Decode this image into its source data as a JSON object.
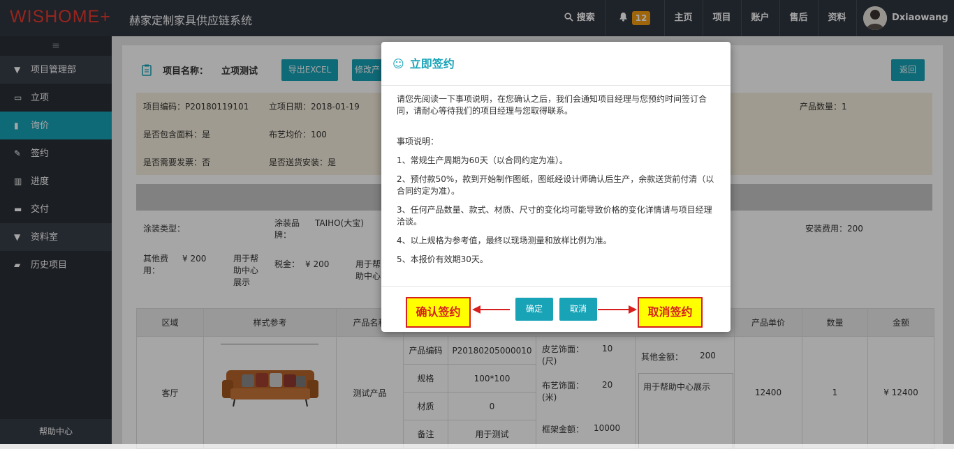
{
  "topbar": {
    "logo": "WISHOME+",
    "system_title": "赫家定制家具供应链系统",
    "search_label": "搜索",
    "notification_count": "12",
    "nav": [
      "主页",
      "项目",
      "账户",
      "售后",
      "资料"
    ],
    "username": "Dxiaowang"
  },
  "sidebar": {
    "toggle": "≡",
    "items": [
      {
        "label": "项目管理部",
        "icon": "caret-down-icon",
        "type": "group"
      },
      {
        "label": "立项",
        "icon": "calendar-icon",
        "type": "item"
      },
      {
        "label": "询价",
        "icon": "file-icon",
        "type": "item",
        "active": true
      },
      {
        "label": "签约",
        "icon": "edit-icon",
        "type": "item"
      },
      {
        "label": "进度",
        "icon": "bar-chart-icon",
        "type": "item"
      },
      {
        "label": "交付",
        "icon": "inbox-icon",
        "type": "item"
      },
      {
        "label": "资料室",
        "icon": "caret-down-icon",
        "type": "group"
      },
      {
        "label": "历史项目",
        "icon": "folder-icon",
        "type": "item"
      }
    ],
    "help": "帮助中心"
  },
  "project": {
    "name_label": "项目名称：",
    "name": "立项测试",
    "export_btn": "导出EXCEL",
    "modify_btn": "修改产",
    "back_btn": "返回",
    "code": "项目编码：P20180119101",
    "date": "立项日期：2018-01-19",
    "quantity": "产品数量：1",
    "includes_fabric": "是否包含面料：是",
    "cloth_avg": "布艺均价：100",
    "need_invoice": "是否需要发票：否",
    "deliver_install": "是否送货安装：是",
    "paint_type_label": "涂装类型：",
    "paint_brand_label": "涂装品牌：",
    "paint_brand_value": "TAIHO(大宝)",
    "install_fee": "安装费用：200",
    "other_fee_label": "其他费用：",
    "other_fee_value": "¥ 200",
    "help_display": "用于帮助中心展示",
    "tax_label": "税金：",
    "tax_value": "¥ 200",
    "help_display_short": "用于帮助中心展"
  },
  "table": {
    "headers": [
      "区域",
      "样式参考",
      "产品名称",
      "产品单价",
      "数量",
      "金额"
    ],
    "row": {
      "area": "客厅",
      "product_name": "测试产品",
      "attrs": [
        {
          "k": "产品编码",
          "v": "P20180205000010"
        },
        {
          "k": "规格",
          "v": "100*100"
        },
        {
          "k": "材质",
          "v": "0"
        },
        {
          "k": "备注",
          "v": "用于测试"
        }
      ],
      "leather_label": "皮艺饰面：(尺)",
      "leather_value": "10",
      "cloth_label": "布艺饰面：(米)",
      "cloth_value": "20",
      "frame_label": "框架金额：",
      "frame_value": "10000",
      "other_amount_label": "其他金额：",
      "other_amount_value": "200",
      "other_note": "用于帮助中心展示",
      "unit_price": "12400",
      "qty": "1",
      "amount": "¥ 12400"
    }
  },
  "modal": {
    "icon": "smile-icon",
    "title": "立即签约",
    "intro": "请您先阅读一下事项说明，在您确认之后，我们会通知项目经理与您预约时间签订合同，请耐心等待我们的项目经理与您取得联系。",
    "items_title": "事项说明：",
    "items": [
      "1、常规生产周期为60天（以合同约定为准）。",
      "2、预付款50%，款到开始制作图纸，图纸经设计师确认后生产，余款送货前付清（以合同约定为准）。",
      "3、任何产品数量、款式、材质、尺寸的变化均可能导致价格的变化详情请与项目经理洽谈。",
      "4、以上规格为参考值，最终以现场测量和放样比例为准。",
      "5、本报价有效期30天。"
    ],
    "confirm_btn": "确定",
    "cancel_btn": "取消"
  },
  "annotations": {
    "confirm_callout": "确认签约",
    "cancel_callout": "取消签约",
    "callout_color": "#d71f1f",
    "callout_bg": "#ffff00"
  },
  "colors": {
    "accent": "#18a3b7",
    "topbar": "#2f353f",
    "sidebar": "#2a2f37",
    "badge": "#f39c12",
    "logo": "#e8392e"
  }
}
